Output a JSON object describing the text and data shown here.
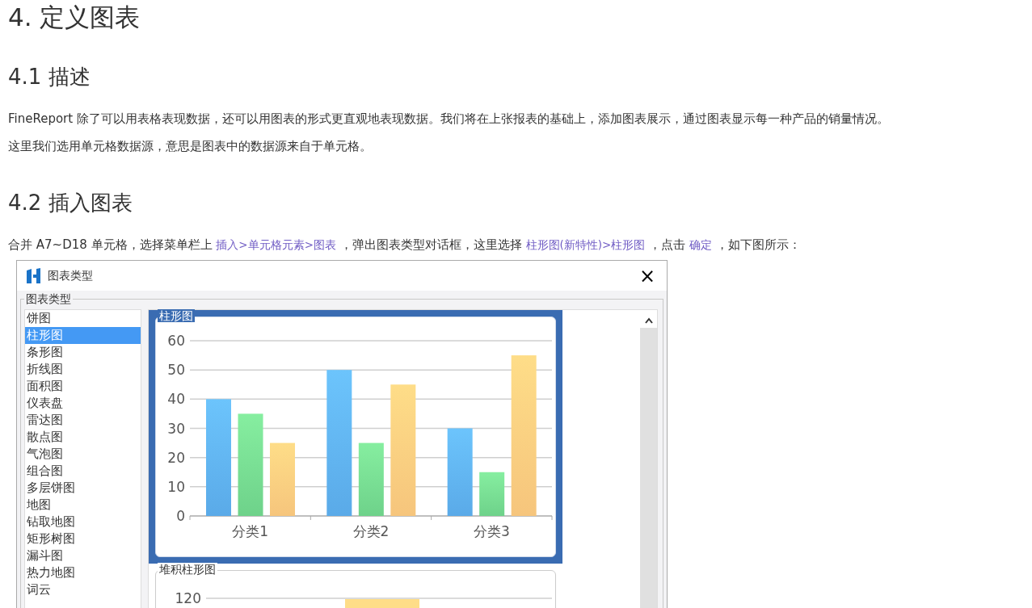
{
  "title": "4. 定义图表",
  "sections": [
    {
      "heading": "4.1 描述",
      "paragraphs": [
        [
          {
            "kind": "text",
            "text": "FineReport 除了可以用表格表现数据，还可以用图表的形式更直观地表现数据。我们将在上张报表的基础上，添加图表展示，通过图表显示每一种产品的销量情况。"
          }
        ],
        [
          {
            "kind": "text",
            "text": "这里我们选用单元格数据源，意思是图表中的数据源来自于单元格。"
          }
        ]
      ]
    },
    {
      "heading": "4.2 插入图表",
      "paragraphs": [
        [
          {
            "kind": "text",
            "text": "合并 A7~D18 单元格，选择菜单栏上 "
          },
          {
            "kind": "link",
            "text": "插入>单元格元素>图表"
          },
          {
            "kind": "text",
            "text": " ，弹出图表类型对话框，这里选择 "
          },
          {
            "kind": "link",
            "text": "柱形图(新特性)>柱形图"
          },
          {
            "kind": "text",
            "text": " ，点击 "
          },
          {
            "kind": "link",
            "text": "确定"
          },
          {
            "kind": "text",
            "text": " ，如下图所示："
          }
        ]
      ]
    }
  ],
  "dialog": {
    "title": "图表类型",
    "close": "×",
    "group_label": "图表类型",
    "chart_types": [
      {
        "label": "饼图",
        "selected": false
      },
      {
        "label": "柱形图",
        "selected": true
      },
      {
        "label": "条形图",
        "selected": false
      },
      {
        "label": "折线图",
        "selected": false
      },
      {
        "label": "面积图",
        "selected": false
      },
      {
        "label": "仪表盘",
        "selected": false
      },
      {
        "label": "雷达图",
        "selected": false
      },
      {
        "label": "散点图",
        "selected": false
      },
      {
        "label": "气泡图",
        "selected": false
      },
      {
        "label": "组合图",
        "selected": false
      },
      {
        "label": "多层饼图",
        "selected": false
      },
      {
        "label": "地图",
        "selected": false
      },
      {
        "label": "钻取地图",
        "selected": false
      },
      {
        "label": "矩形树图",
        "selected": false
      },
      {
        "label": "漏斗图",
        "selected": false
      },
      {
        "label": "热力地图",
        "selected": false
      },
      {
        "label": "词云",
        "selected": false
      }
    ],
    "previews": [
      {
        "title": "柱形图",
        "selected": true,
        "chart_data": {
          "type": "bar",
          "categories": [
            "分类1",
            "分类2",
            "分类3"
          ],
          "series": [
            {
              "color": "#6cc4fc",
              "values": [
                40,
                50,
                30
              ]
            },
            {
              "color": "#86eea0",
              "values": [
                35,
                25,
                15
              ]
            },
            {
              "color": "#fedd88",
              "values": [
                25,
                45,
                55
              ]
            }
          ],
          "grid": true,
          "ylim": [
            0,
            60
          ],
          "yticks": [
            0,
            10,
            20,
            30,
            40,
            50,
            60
          ]
        }
      },
      {
        "title": "堆积柱形图",
        "selected": false,
        "ytick": "120"
      }
    ]
  }
}
